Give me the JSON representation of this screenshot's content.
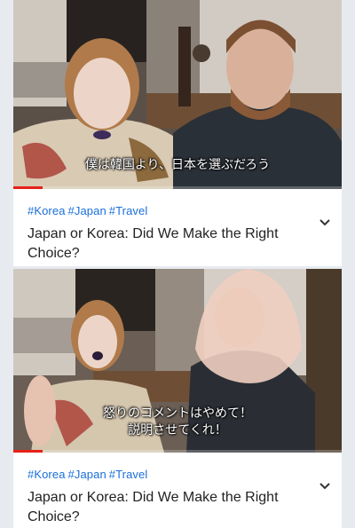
{
  "colors": {
    "hashtag": "#1a6ed8",
    "progress": "#e62117",
    "background": "#e7ebf0"
  },
  "cards": [
    {
      "subtitle": "僕は韓国より、日本を選ぶだろう",
      "hashtags": [
        "#Korea",
        "#Japan",
        "#Travel"
      ],
      "title": "Japan or Korea: Did We Make the Right Choice?",
      "progress": 0.09,
      "menu_icon": "chevron-down-icon"
    },
    {
      "subtitle": "怒りのコメントはやめて！\n説明させてくれ！",
      "hashtags": [
        "#Korea",
        "#Japan",
        "#Travel"
      ],
      "title": "Japan or Korea: Did We Make the Right Choice?",
      "progress": 0.09,
      "menu_icon": "chevron-down-icon"
    }
  ]
}
